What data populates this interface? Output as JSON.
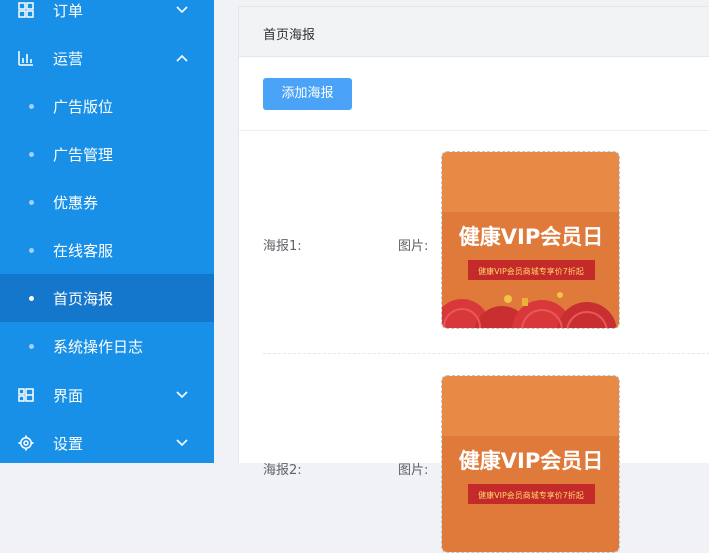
{
  "sidebar": {
    "menus": [
      {
        "label": "订单",
        "icon": "grid-icon",
        "arrow": "chevron-down-icon"
      },
      {
        "label": "运营",
        "icon": "bar-chart-icon",
        "arrow": "chevron-up-icon"
      }
    ],
    "sub_items": [
      {
        "label": "广告版位",
        "active": false
      },
      {
        "label": "广告管理",
        "active": false
      },
      {
        "label": "优惠券",
        "active": false
      },
      {
        "label": "在线客服",
        "active": false
      },
      {
        "label": "首页海报",
        "active": true
      },
      {
        "label": "系统操作日志",
        "active": false
      }
    ],
    "bottom_menus": [
      {
        "label": "界面",
        "icon": "layout-icon",
        "arrow": "chevron-down-icon"
      },
      {
        "label": "设置",
        "icon": "gear-icon",
        "arrow": "chevron-down-icon"
      }
    ]
  },
  "main": {
    "breadcrumb": "首页海报",
    "add_button": "添加海报",
    "posters": [
      {
        "label": "海报1:",
        "image_label": "图片:",
        "banner_title": "健康VIP会员日",
        "banner_subtitle": "健康VIP会员商城专享价7折起"
      },
      {
        "label": "海报2:",
        "image_label": "图片:",
        "banner_title": "健康VIP会员日",
        "banner_subtitle": "健康VIP会员商城专享价7折起"
      }
    ]
  },
  "colors": {
    "sidebar_bg": "#1890e8",
    "sidebar_active": "#1477cc",
    "button_bg": "#4ba3f7",
    "poster_orange": "#e07a3a",
    "poster_red": "#d9383a"
  }
}
